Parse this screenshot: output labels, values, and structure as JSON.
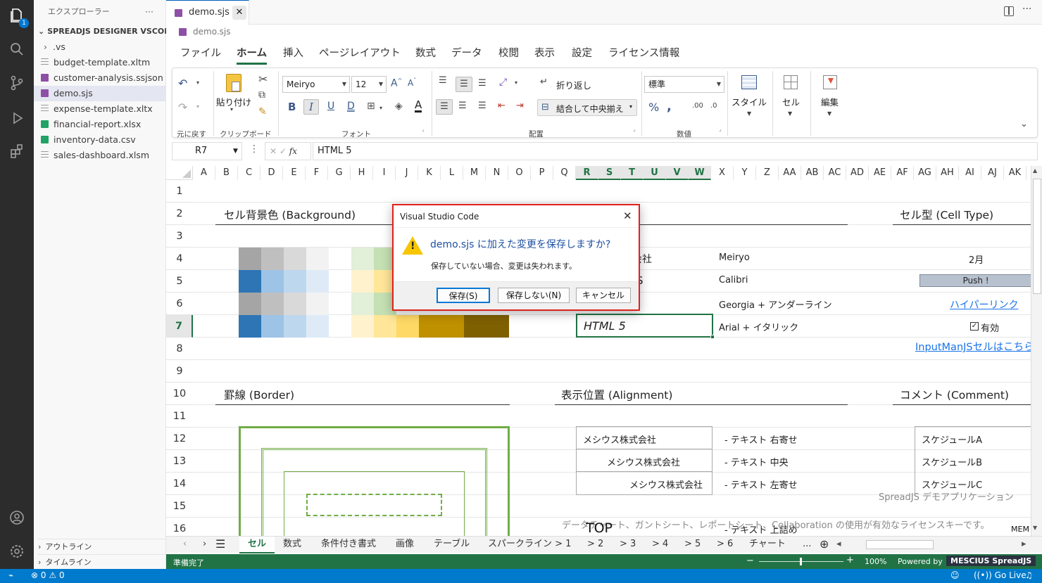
{
  "activity": {
    "badge": "1"
  },
  "sidebar": {
    "title": "エクスプローラー",
    "more": "···",
    "root": "SPREADJS DESIGNER VSCODE...",
    "items": [
      {
        "label": ".vs",
        "kind": "folder"
      },
      {
        "label": "budget-template.xltm",
        "kind": "file"
      },
      {
        "label": "customer-analysis.ssjson",
        "kind": "sjs"
      },
      {
        "label": "demo.sjs",
        "kind": "sjs"
      },
      {
        "label": "expense-template.xltx",
        "kind": "file"
      },
      {
        "label": "financial-report.xlsx",
        "kind": "xlsx"
      },
      {
        "label": "inventory-data.csv",
        "kind": "xlsx"
      },
      {
        "label": "sales-dashboard.xlsm",
        "kind": "file"
      }
    ],
    "outline": "アウトライン",
    "timeline": "タイムライン"
  },
  "editor": {
    "tab": "demo.sjs",
    "breadcrumb": "demo.sjs"
  },
  "ribbon": {
    "tabs": [
      "ファイル",
      "ホーム",
      "挿入",
      "ページレイアウト",
      "数式",
      "データ",
      "校閲",
      "表示",
      "設定",
      "ライセンス情報"
    ],
    "active_tab": "ホーム",
    "groups": {
      "undo": "元に戻す",
      "clipboard": "クリップボード",
      "font": "フォント",
      "align": "配置",
      "number": "数値"
    },
    "paste": "貼り付け",
    "font_name": "Meiryo",
    "font_size": "12",
    "wrap": "折り返し",
    "merge": "結合して中央揃え",
    "number_format": "標準",
    "style": "スタイル",
    "cell": "セル",
    "edit": "編集"
  },
  "formula": {
    "namebox": "R7",
    "fx": "fx",
    "value": "HTML 5"
  },
  "grid": {
    "columns": [
      "A",
      "B",
      "C",
      "D",
      "E",
      "F",
      "G",
      "H",
      "I",
      "J",
      "K",
      "L",
      "M",
      "N",
      "O",
      "P",
      "Q",
      "R",
      "S",
      "T",
      "U",
      "V",
      "W",
      "X",
      "Y",
      "Z",
      "AA",
      "AB",
      "AC",
      "AD",
      "AE",
      "AF",
      "AG",
      "AH",
      "AI",
      "AJ",
      "AK"
    ],
    "selected_columns": [
      "R",
      "S",
      "T",
      "U",
      "V",
      "W"
    ],
    "rows": [
      "1",
      "2",
      "3",
      "4",
      "5",
      "6",
      "7",
      "8",
      "9",
      "10",
      "11",
      "12",
      "13",
      "14",
      "15",
      "16"
    ],
    "selected_row": "7",
    "headings": {
      "background": "セル背景色 (Background)",
      "celltype": "セル型 (Cell Type)",
      "border": "罫線 (Border)",
      "alignment": "表示位置 (Alignment)",
      "comment": "コメント (Comment)"
    },
    "cells": {
      "r4_company": "会社",
      "r5_s": "S",
      "r7_html": "HTML 5",
      "font_meiryo": "Meiryo",
      "font_calibri": "Calibri",
      "font_georgia": "Georgia + アンダーライン",
      "font_arial": "Arial + イタリック",
      "month": "2月",
      "push": "Push !",
      "hyperlink": "ハイパーリンク",
      "checkbox": "有効",
      "inputman": "InputManJSセルはこちら",
      "align_right": "メシウス株式会社",
      "align_center": "メシウス株式会社",
      "align_left": "メシウス株式会社",
      "text_right": "- テキスト 右寄せ",
      "text_center": "- テキスト 中央",
      "text_left": "- テキスト 左寄せ",
      "text_top": "- テキスト 上詰め",
      "sched_a": "スケジュールA",
      "sched_b": "スケジュールB",
      "sched_c": "スケジュールC",
      "watermark1": "SpreadJS デモアプリケーション",
      "watermark2": "データチャート、ガントシート、レポートシート、Collaboration の使用が有効なライセンスキーです。",
      "top": "TOP",
      "mem": "MEM"
    }
  },
  "sheets": {
    "tabs": [
      "セル",
      "数式",
      "条件付き書式",
      "画像",
      "テーブル",
      "スパークライン > 1",
      "> 2",
      "> 3",
      "> 4",
      "> 5",
      "> 6",
      "チャート"
    ],
    "active": "セル",
    "more": "..."
  },
  "statusbar": {
    "ready": "準備完了",
    "zoom": "100%",
    "powered": "Powered by",
    "brand": "MESCIUS SpreadJS"
  },
  "vscode_status": {
    "errors": "0",
    "warnings": "0",
    "golive": "Go Live"
  },
  "dialog": {
    "title": "Visual Studio Code",
    "message": "demo.sjs に加えた変更を保存しますか?",
    "detail": "保存していない場合、変更は失われます。",
    "save": "保存(S)",
    "dont_save": "保存しない(N)",
    "cancel": "キャンセル"
  },
  "colors": {
    "excel_green": "#217346",
    "vscode_blue": "#007acc",
    "dialog_border": "#e0211c",
    "link": "#1a73e8"
  }
}
